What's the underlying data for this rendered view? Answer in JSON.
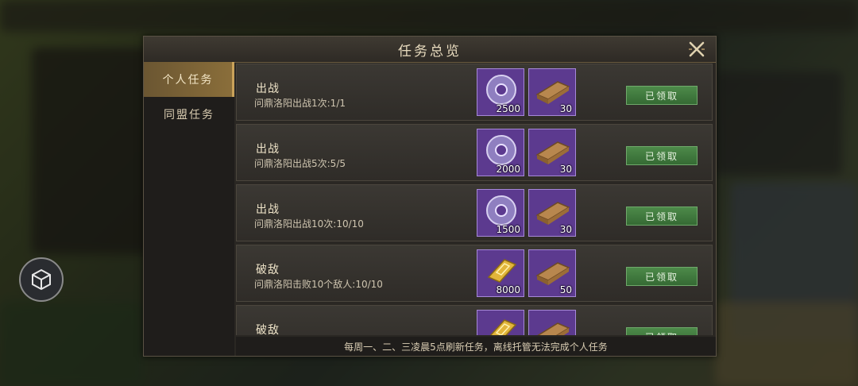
{
  "dialog": {
    "title": "任务总览",
    "close_icon": "close-x-icon"
  },
  "tabs": [
    {
      "label": "个人任务",
      "active": true
    },
    {
      "label": "同盟任务",
      "active": false
    }
  ],
  "tasks": [
    {
      "title": "出战",
      "desc": "问鼎洛阳出战1次:1/1",
      "rewards": [
        {
          "icon": "jade-disc-icon",
          "qty": "2500"
        },
        {
          "icon": "wood-plank-icon",
          "qty": "30"
        }
      ],
      "button": "已领取"
    },
    {
      "title": "出战",
      "desc": "问鼎洛阳出战5次:5/5",
      "rewards": [
        {
          "icon": "jade-disc-icon",
          "qty": "2000"
        },
        {
          "icon": "wood-plank-icon",
          "qty": "30"
        }
      ],
      "button": "已领取"
    },
    {
      "title": "出战",
      "desc": "问鼎洛阳出战10次:10/10",
      "rewards": [
        {
          "icon": "jade-disc-icon",
          "qty": "1500"
        },
        {
          "icon": "wood-plank-icon",
          "qty": "30"
        }
      ],
      "button": "已领取"
    },
    {
      "title": "破敌",
      "desc": "问鼎洛阳击败10个敌人:10/10",
      "rewards": [
        {
          "icon": "gold-ingot-icon",
          "qty": "8000"
        },
        {
          "icon": "wood-plank-icon",
          "qty": "50"
        }
      ],
      "button": "已领取"
    },
    {
      "title": "破敌",
      "desc": "",
      "rewards": [
        {
          "icon": "gold-ingot-icon",
          "qty": ""
        },
        {
          "icon": "wood-plank-icon",
          "qty": ""
        }
      ],
      "button": "已领取"
    }
  ],
  "footer": "每周一、二、三凌晨5点刷新任务，离线托管无法完成个人任务",
  "colors": {
    "accent": "#c9a25a",
    "claim_green": "#4d8a4a",
    "item_purple": "#5c3a8f"
  }
}
